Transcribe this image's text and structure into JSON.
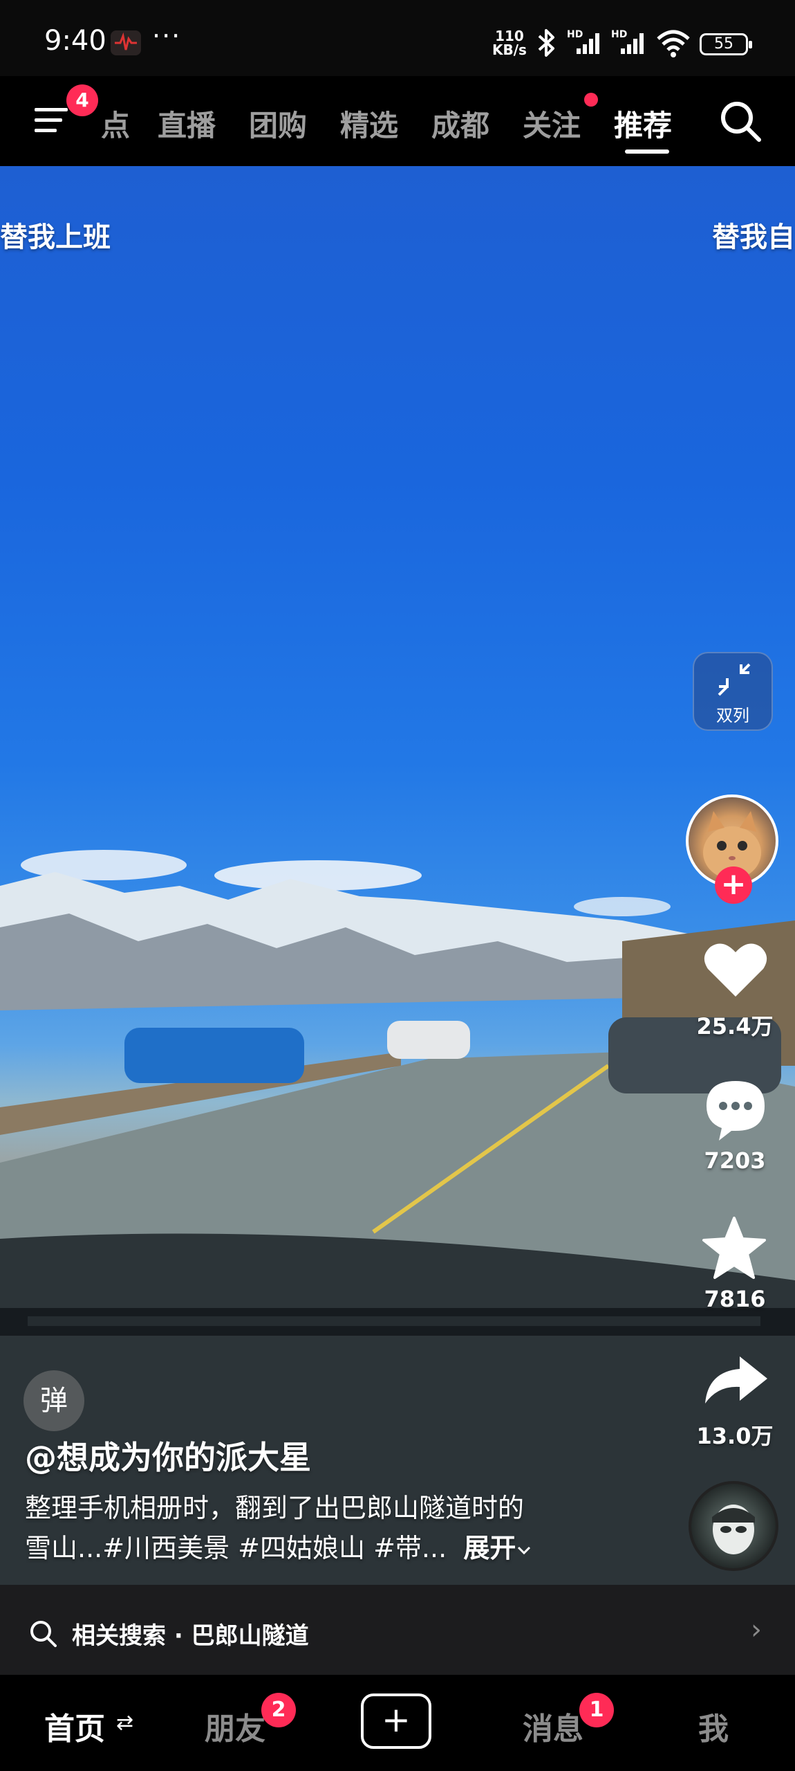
{
  "status_bar": {
    "time": "9:40",
    "dots": "···",
    "net_speed_value": "110",
    "net_speed_unit": "KB/s",
    "signal_label_1": "HD",
    "signal_label_2": "HD",
    "battery": "55"
  },
  "top_nav": {
    "menu_badge": "4",
    "tabs": [
      {
        "label": "点"
      },
      {
        "label": "直播"
      },
      {
        "label": "团购"
      },
      {
        "label": "精选"
      },
      {
        "label": "成都"
      },
      {
        "label": "关注"
      },
      {
        "label": "推荐",
        "active": true
      }
    ]
  },
  "video": {
    "side_left": "替我上班",
    "side_right": "替我自",
    "double_column_label": "双列",
    "likes": "25.4万",
    "comments": "7203",
    "favorites": "7816",
    "shares": "13.0万",
    "danmaku_label": "弹",
    "author": "@想成为你的派大星",
    "caption_line1": "整理手机相册时，翻到了出巴郎山隧道时的",
    "caption_line2": "雪山...#川西美景 #四姑娘山 #带...",
    "expand_label": "展开"
  },
  "related_search": {
    "text": "相关搜索 · 巴郎山隧道",
    "arrow": "›"
  },
  "bottom_nav": {
    "home": "首页",
    "home_swap": "⇄",
    "friends": "朋友",
    "friends_badge": "2",
    "add": "+",
    "messages": "消息",
    "messages_badge": "1",
    "me": "我"
  },
  "colors": {
    "accent": "#ff2b56",
    "sky": "#1e5fd2",
    "bar_bg": "#1c1c1e"
  }
}
